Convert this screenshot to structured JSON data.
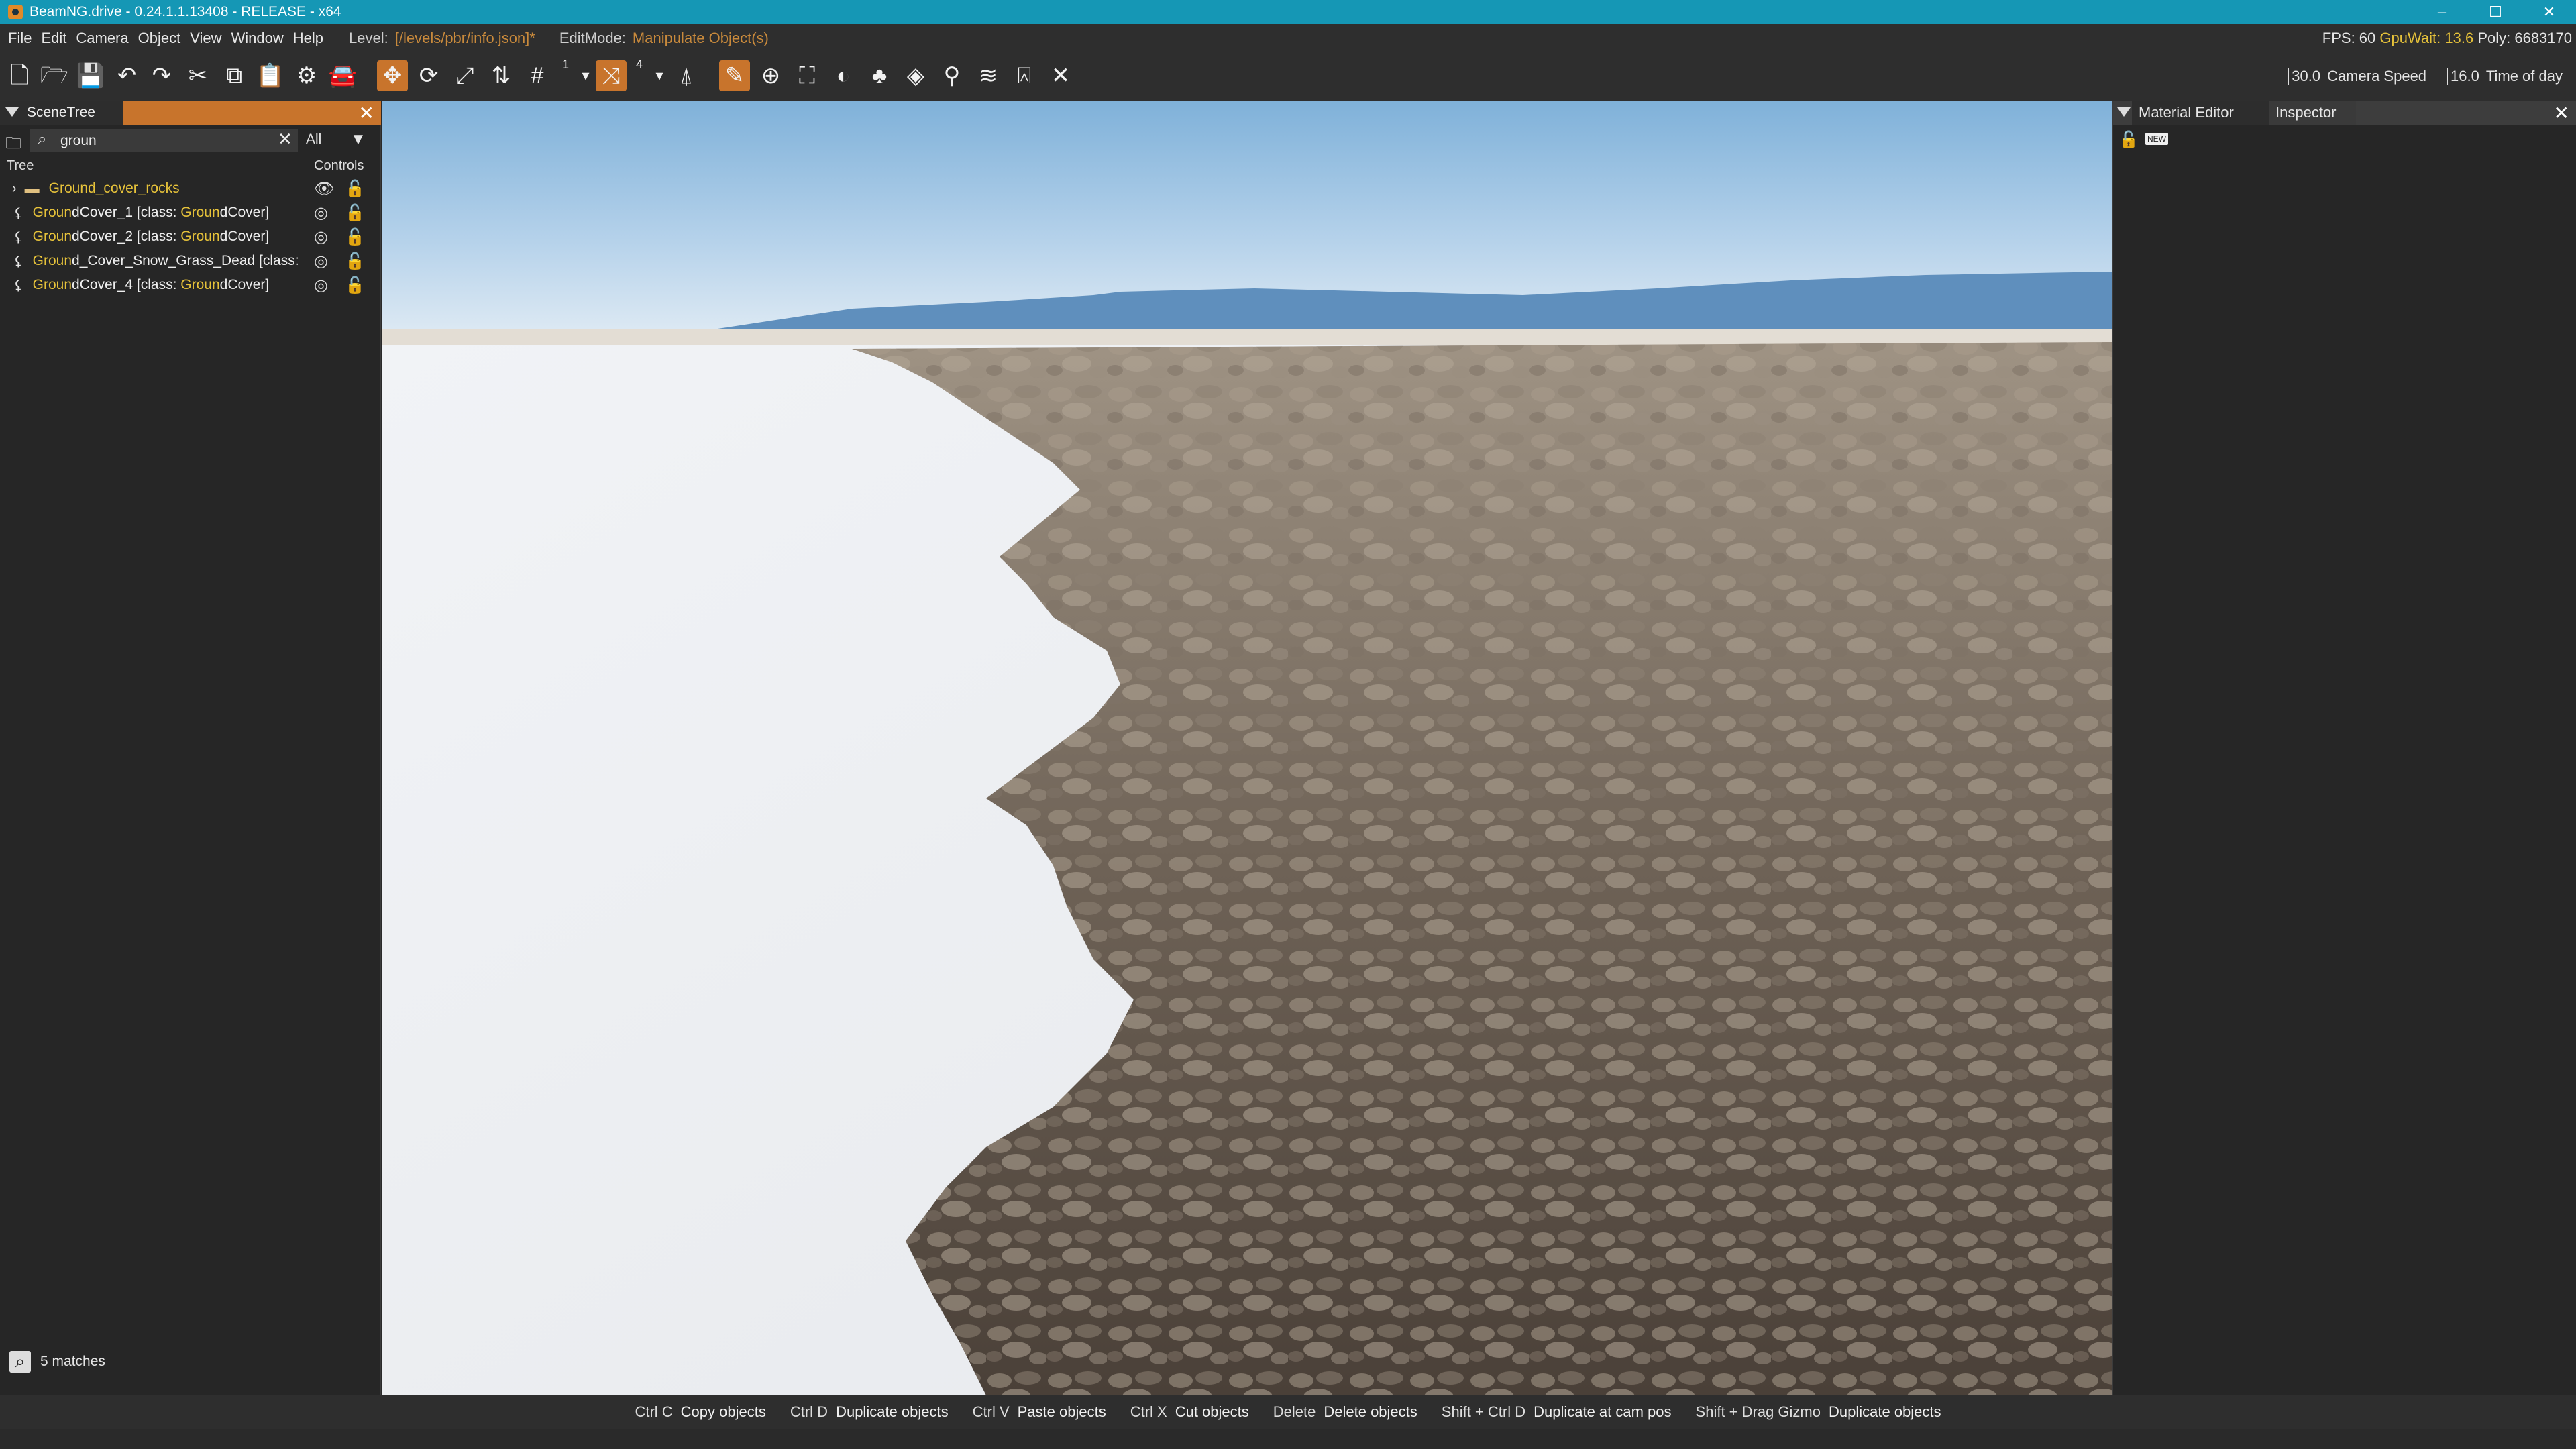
{
  "window": {
    "title": "BeamNG.drive - 0.24.1.1.13408 - RELEASE - x64",
    "controls": [
      "–",
      "☐",
      "✕"
    ]
  },
  "menu": {
    "items": [
      "File",
      "Edit",
      "Camera",
      "Object",
      "View",
      "Window",
      "Help"
    ],
    "level_label": "Level:",
    "level_value": "[/levels/pbr/info.json]*",
    "editmode_label": "EditMode:",
    "editmode_value": "Manipulate Object(s)"
  },
  "stats": {
    "fps_label": "FPS: 60",
    "gpuwait_label": "GpuWait: 13.6",
    "poly_label": "Poly: 6683170"
  },
  "toolbar": {
    "icons": [
      "new-file-icon",
      "open-folder-icon",
      "save-icon",
      "undo-icon",
      "redo-icon",
      "cut-icon",
      "copy-icon",
      "paste-icon",
      "settings-gear-icon",
      "vehicle-icon",
      "move-gizmo-icon",
      "rotate-gizmo-icon",
      "scale-gizmo-icon",
      "snap-axis-icon",
      "grid-snap-icon",
      "terrain-snap-icon",
      "road-icon",
      "light-icon",
      "pencil-icon",
      "add-icon",
      "decal-icon",
      "terrain-icon",
      "forest-icon",
      "mesh-icon",
      "spawn-icon",
      "river-icon",
      "path-icon",
      "crosshair-icon"
    ],
    "snap_value_1": "1",
    "snap_value_2": "4",
    "camera_speed_value": "30.0",
    "camera_speed_label": "Camera Speed",
    "time_of_day_value": "16.0",
    "time_of_day_label": "Time of day"
  },
  "scene_tree": {
    "tab_title": "SceneTree",
    "search_value": "groun",
    "filter_value": "All",
    "col_tree": "Tree",
    "col_controls": "Controls",
    "rows": [
      {
        "pre": "",
        "hl": "Groun",
        "post": "d_cover_rocks",
        "type": "folder"
      },
      {
        "pre": "",
        "hl": "Groun",
        "post": "dCover_1 [class: ",
        "hl2": "Groun",
        "post2": "dCover]",
        "type": "object"
      },
      {
        "pre": "",
        "hl": "Groun",
        "post": "dCover_2 [class: ",
        "hl2": "Groun",
        "post2": "dCover]",
        "type": "object"
      },
      {
        "pre": "",
        "hl": "Groun",
        "post": "d_Cover_Snow_Grass_Dead [class:",
        "hl2": "",
        "post2": "",
        "type": "object"
      },
      {
        "pre": "",
        "hl": "Groun",
        "post": "dCover_4 [class: ",
        "hl2": "Groun",
        "post2": "dCover]",
        "type": "object"
      }
    ],
    "matches": "5 matches"
  },
  "right_panel": {
    "tab_material": "Material Editor",
    "tab_inspector": "Inspector",
    "new_badge": "NEW"
  },
  "statusbar": [
    {
      "key": "Ctrl C",
      "desc": "Copy objects"
    },
    {
      "key": "Ctrl D",
      "desc": "Duplicate objects"
    },
    {
      "key": "Ctrl V",
      "desc": "Paste objects"
    },
    {
      "key": "Ctrl X",
      "desc": "Cut objects"
    },
    {
      "key": "Delete",
      "desc": "Delete objects"
    },
    {
      "key": "Shift + Ctrl D",
      "desc": "Duplicate at cam pos"
    },
    {
      "key": "Shift + Drag Gizmo",
      "desc": "Duplicate objects"
    }
  ],
  "colors": {
    "titlebar": "#1597b5",
    "accent": "#c8742c",
    "highlight_text": "#e6c23a"
  }
}
